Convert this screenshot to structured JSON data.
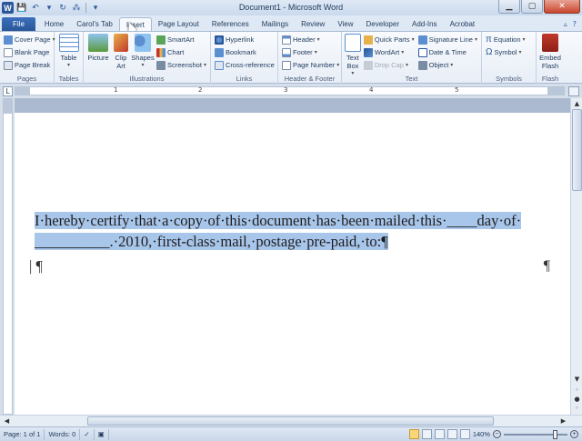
{
  "window": {
    "title": "Document1 - Microsoft Word",
    "logo": "W",
    "min": "▁",
    "max": "▢",
    "close": "✕"
  },
  "qat": {
    "save": "💾",
    "undo": "↶",
    "undo_dd": "▾",
    "redo": "↻",
    "format": "⁂",
    "customize": "▾"
  },
  "tabs": {
    "file": "File",
    "home": "Home",
    "carols": "Carol's Tab",
    "insert": "Insert",
    "page_layout": "Page Layout",
    "references": "References",
    "mailings": "Mailings",
    "review": "Review",
    "view": "View",
    "developer": "Developer",
    "addins": "Add-Ins",
    "acrobat": "Acrobat",
    "minimize_icon": "▵",
    "help_icon": "?"
  },
  "ribbon": {
    "pages": {
      "label": "Pages",
      "cover_page": "Cover Page",
      "blank_page": "Blank Page",
      "page_break": "Page Break"
    },
    "tables": {
      "label": "Tables",
      "table": "Table"
    },
    "illustrations": {
      "label": "Illustrations",
      "picture": "Picture",
      "clip_art": "Clip Art",
      "shapes": "Shapes",
      "smartart": "SmartArt",
      "chart": "Chart",
      "screenshot": "Screenshot"
    },
    "links": {
      "label": "Links",
      "hyperlink": "Hyperlink",
      "bookmark": "Bookmark",
      "cross_reference": "Cross-reference"
    },
    "header_footer": {
      "label": "Header & Footer",
      "header": "Header",
      "footer": "Footer",
      "page_number": "Page Number"
    },
    "text": {
      "label": "Text",
      "text_box": "Text Box",
      "quick_parts": "Quick Parts",
      "wordart": "WordArt",
      "drop_cap": "Drop Cap",
      "signature_line": "Signature Line",
      "date_time": "Date & Time",
      "object": "Object"
    },
    "symbols": {
      "label": "Symbols",
      "equation": "Equation",
      "symbol": "Symbol"
    },
    "flash": {
      "label": "Flash",
      "embed_flash": "Embed Flash"
    },
    "dropdown": "▾"
  },
  "ruler": {
    "corner": "L",
    "n1": "1",
    "n2": "2",
    "n3": "3",
    "n4": "4",
    "n5": "5"
  },
  "document": {
    "line1": "I·hereby·certify·that·a·copy·of·this·document·has·been·mailed·this·____day·of·",
    "line2": "__________.·2010,·first-class·mail,·postage·pre-paid,·to:¶",
    "line3": "¶",
    "pilcrow_right": "¶"
  },
  "scroll": {
    "up": "▲",
    "down": "▼",
    "prev": "◦",
    "browse": "●",
    "next": "◦",
    "left": "◀",
    "right": "▶"
  },
  "status": {
    "page": "Page: 1 of 1",
    "words": "Words: 0",
    "zoom": "140%",
    "zoom_out": "−",
    "zoom_in": "+"
  }
}
